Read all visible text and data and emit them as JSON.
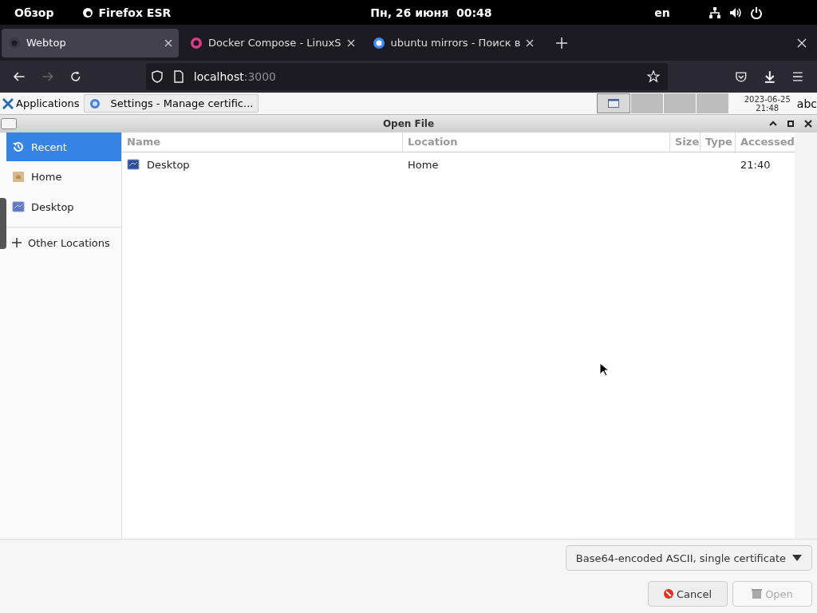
{
  "top_bar": {
    "overview": "Обзор",
    "app": "Firefox ESR",
    "datetime": "Пн, 26 июня  00:48",
    "language": "en"
  },
  "tabs": [
    {
      "label": "Webtop",
      "selected": true
    },
    {
      "label": "Docker Compose - LinuxS",
      "selected": false
    },
    {
      "label": "ubuntu mirrors - Поиск в",
      "selected": false
    }
  ],
  "address": {
    "host": "localhost",
    "port": ":3000"
  },
  "taskbar": {
    "menu": "Applications",
    "task": "Settings - Manage certific...",
    "clock_date": "2023-06-25",
    "clock_time": "21:48",
    "keyboard": "abc"
  },
  "dialog": {
    "title": "Open File",
    "places": [
      {
        "label": "Recent",
        "kind": "recent",
        "selected": true
      },
      {
        "label": "Home",
        "kind": "home",
        "selected": false
      },
      {
        "label": "Desktop",
        "kind": "desktop",
        "selected": false
      },
      {
        "label": "Other Locations",
        "kind": "other",
        "selected": false
      }
    ],
    "columns": [
      "Name",
      "Location",
      "Size",
      "Type",
      "Accessed"
    ],
    "rows": [
      {
        "name": "Desktop",
        "location": "Home",
        "size": "",
        "type": "",
        "accessed": "21:40"
      }
    ],
    "format": "Base64-encoded ASCII, single certificate",
    "buttons": [
      {
        "label": "Cancel",
        "kind": "cancel",
        "disabled": false
      },
      {
        "label": "Open",
        "kind": "open",
        "disabled": true
      }
    ]
  }
}
